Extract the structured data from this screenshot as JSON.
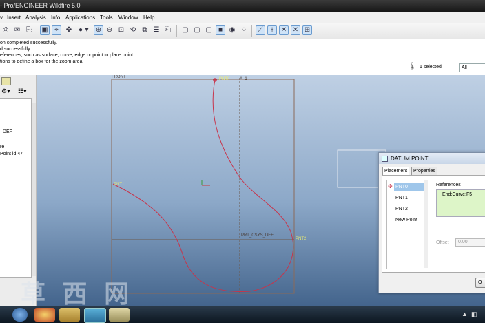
{
  "window": {
    "title": "- Pro/ENGINEER Wildfire 5.0"
  },
  "menu": [
    "v",
    "Insert",
    "Analysis",
    "Info",
    "Applications",
    "Tools",
    "Window",
    "Help"
  ],
  "messages": [
    "on completed successfully.",
    "d successfully.",
    "eferences, such as surface, curve, edge or point to place point.",
    "tions to define a box for the zoom area."
  ],
  "selection": {
    "count_text": "1 selected",
    "filter_value": "All"
  },
  "model_tree": [
    "_DEF",
    "re",
    "Point id 47"
  ],
  "viewport_labels": {
    "front": "FRONT",
    "axis": "A_1",
    "pnt0": "PNT0",
    "pnt1": "PNT1",
    "pnt2": "PNT2",
    "csys": "PRT_CSYS_DEF"
  },
  "dialog": {
    "title": "DATUM POINT",
    "tabs": [
      "Placement",
      "Properties"
    ],
    "points": [
      "PNT0",
      "PNT1",
      "PNT2",
      "New Point"
    ],
    "references_label": "References",
    "reference_value": "End:Curve:F5",
    "offset_label": "Offset",
    "offset_value": "0.00",
    "button_label": "O"
  },
  "watermark": "草 西 网",
  "colors": {
    "curve": "#c8334a",
    "datum": "#8a6a5a",
    "viewport_top": "#bfd0e4",
    "viewport_bottom": "#43648c",
    "list_selection": "#9fc6ea",
    "reference_bg": "#ddf5c8"
  }
}
